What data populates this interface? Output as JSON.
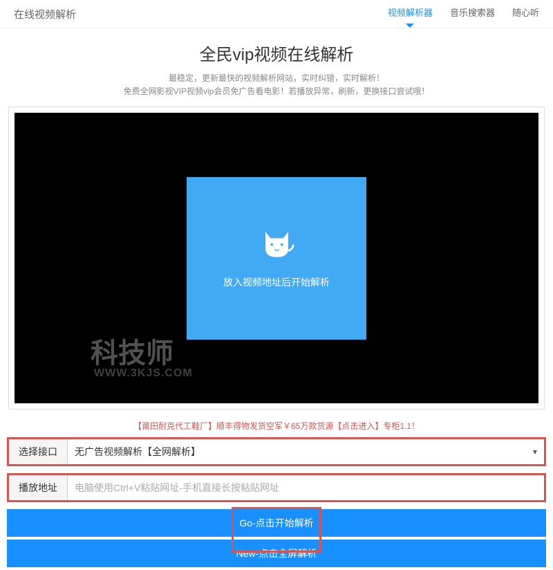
{
  "header": {
    "site_title": "在线视频解析",
    "nav": [
      {
        "label": "视频解析器",
        "active": true
      },
      {
        "label": "音乐搜索器",
        "active": false
      },
      {
        "label": "随心听",
        "active": false
      }
    ]
  },
  "page_title": "全民vip视频在线解析",
  "subtitle_line1": "最稳定，更新最快的视频解析网站，实时纠错，实时解析！",
  "subtitle_line2": "免费全网影视VIP视频vip会员免广告看电影！若播放异常，刷新，更换接口尝试哦！",
  "video": {
    "placeholder_text": "放入视频地址后开始解析"
  },
  "watermark": {
    "main": "科技师",
    "sub": "WWW.3KJS.COM"
  },
  "promo_text": "【莆田耐克代工鞋厂】顺丰得物发货空军￥65万款货源【点击进入】专柜1.1！",
  "form": {
    "interface_label": "选择接口",
    "interface_value": "无广告视频解析【全网解析】",
    "url_label": "播放地址",
    "url_placeholder": "电脑使用Ctrl+V粘贴网址-手机直接长按粘贴网址"
  },
  "buttons": {
    "go_label": "Go-点击开始解析",
    "new_label": "New-点击全屏解析"
  }
}
